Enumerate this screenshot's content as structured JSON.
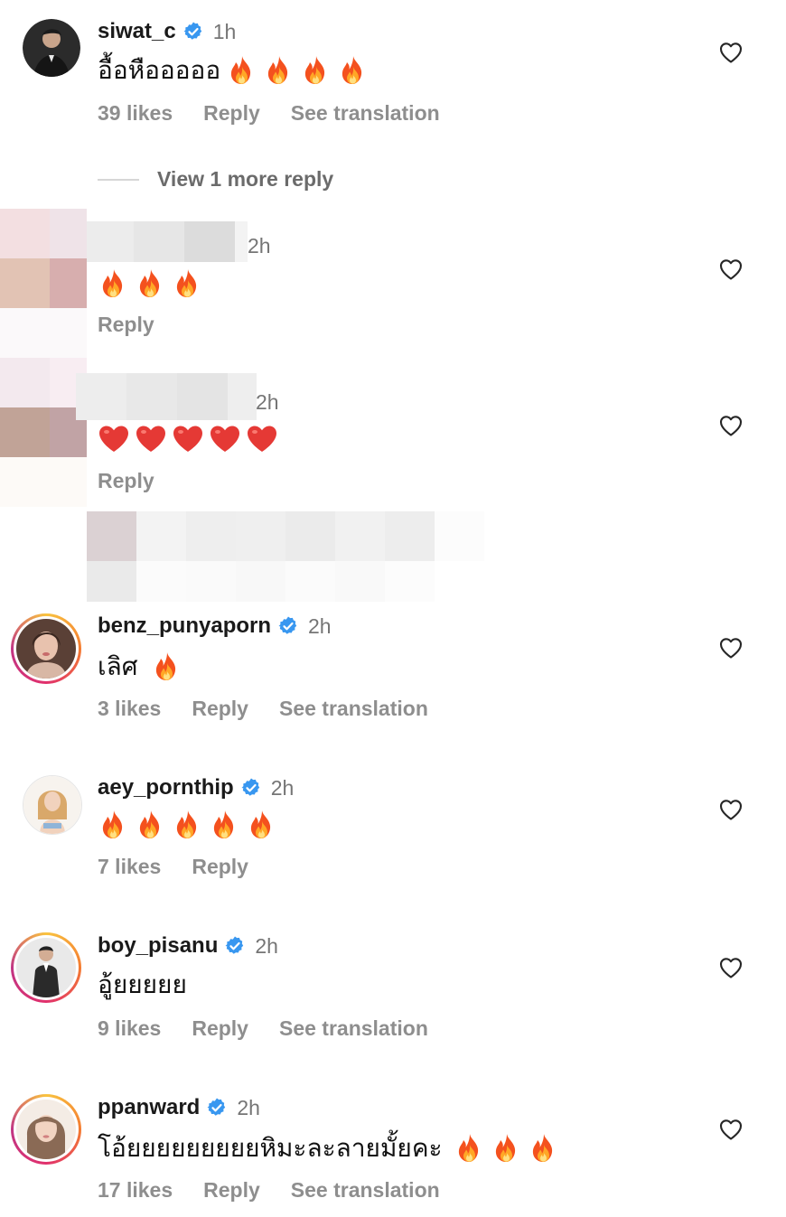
{
  "comments": [
    {
      "username": "siwat_c",
      "verified": true,
      "time": "1h",
      "text": "อื้อหือออออ",
      "emojis": [
        "fire",
        "fire",
        "fire",
        "fire"
      ],
      "likes": "39 likes",
      "reply": "Reply",
      "translate": "See translation"
    },
    {
      "username": "",
      "time": "2h",
      "emojis": [
        "fire",
        "fire",
        "fire"
      ],
      "reply": "Reply"
    },
    {
      "username": "",
      "time": "2h",
      "emojis": [
        "red-heart",
        "red-heart",
        "red-heart",
        "red-heart",
        "red-heart"
      ],
      "reply": "Reply"
    },
    {
      "username": "benz_punyaporn",
      "verified": true,
      "time": "2h",
      "text": "เลิศ",
      "emojis": [
        "fire"
      ],
      "likes": "3 likes",
      "reply": "Reply",
      "translate": "See translation"
    },
    {
      "username": "aey_pornthip",
      "verified": true,
      "time": "2h",
      "emojis": [
        "fire",
        "fire",
        "fire",
        "fire",
        "fire"
      ],
      "likes": "7 likes",
      "reply": "Reply"
    },
    {
      "username": "boy_pisanu",
      "verified": true,
      "time": "2h",
      "text": "อู้ยยยยย",
      "likes": "9 likes",
      "reply": "Reply",
      "translate": "See translation"
    },
    {
      "username": "ppanward",
      "verified": true,
      "time": "2h",
      "text": "โอ้ยยยยยยยยยหิมะละลายมั้ยคะ",
      "emojis": [
        "fire",
        "fire",
        "fire"
      ],
      "likes": "17 likes",
      "reply": "Reply",
      "translate": "See translation"
    }
  ],
  "view_more": "View 1 more reply",
  "colors": {
    "verified_blue": "#3897f0",
    "meta_gray": "#8e8e8e",
    "story_ring": [
      "#f9c33f",
      "#f47b30",
      "#e1306c",
      "#c13584"
    ]
  },
  "icons": {
    "like": "heart-outline-icon",
    "verified": "verified-badge-icon",
    "fire": "fire-emoji",
    "red_heart": "red-heart-emoji"
  }
}
